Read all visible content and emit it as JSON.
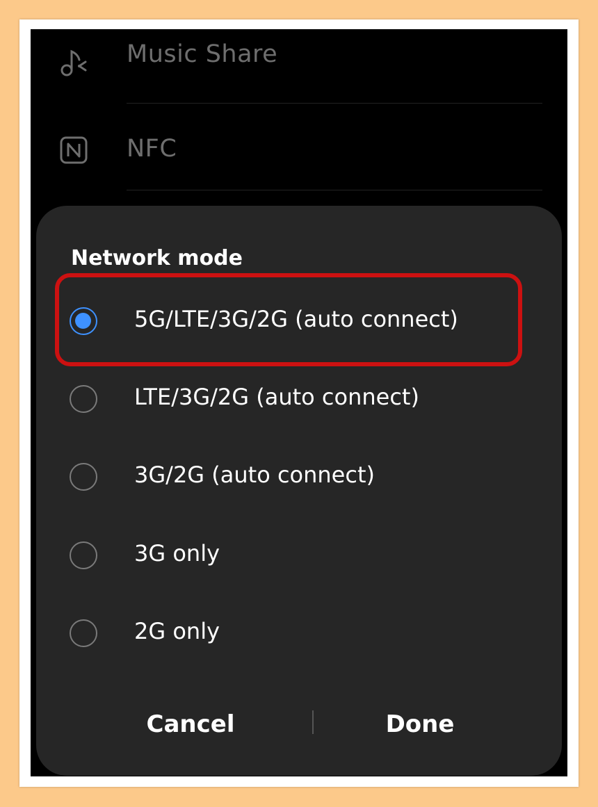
{
  "background_settings": {
    "items": [
      {
        "label": "Music Share",
        "icon": "music-share-icon"
      },
      {
        "label": "NFC",
        "icon": "nfc-icon"
      }
    ]
  },
  "dialog": {
    "title": "Network mode",
    "options": [
      {
        "label": "5G/LTE/3G/2G (auto connect)",
        "selected": true
      },
      {
        "label": "LTE/3G/2G (auto connect)",
        "selected": false
      },
      {
        "label": "3G/2G (auto connect)",
        "selected": false
      },
      {
        "label": "3G only",
        "selected": false
      },
      {
        "label": "2G only",
        "selected": false
      }
    ],
    "cancel_label": "Cancel",
    "done_label": "Done"
  },
  "colors": {
    "accent": "#3e91ff",
    "highlight": "#cc1111",
    "dialog_bg": "#262626",
    "page_bg": "#fcc98a"
  }
}
